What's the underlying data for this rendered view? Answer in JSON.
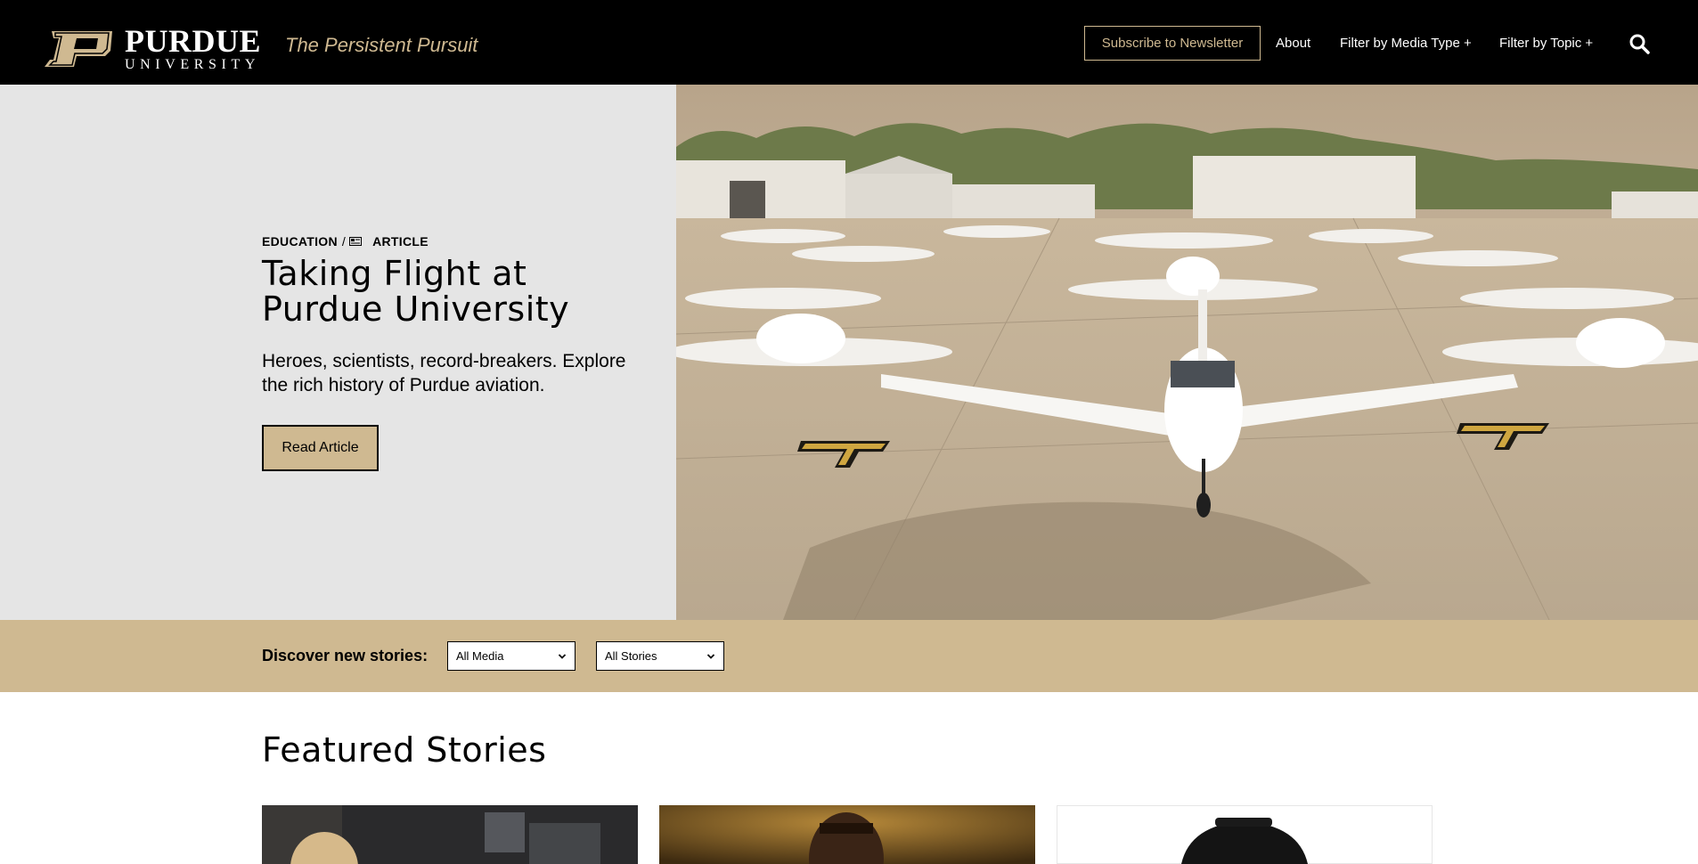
{
  "header": {
    "logo_word": "PURDUE",
    "logo_sub": "UNIVERSITY",
    "tagline": "The Persistent Pursuit",
    "subscribe_label": "Subscribe to Newsletter",
    "nav": {
      "about": "About",
      "media_type": "Filter by Media Type +",
      "topic": "Filter by Topic +"
    },
    "icons": {
      "search": "search-icon",
      "logo": "purdue-p-logo"
    }
  },
  "hero": {
    "category": "EDUCATION",
    "separator": "/",
    "media_type": "ARTICLE",
    "media_icon": "article-card-icon",
    "title": "Taking Flight at Purdue University",
    "description": "Heroes, scientists, record-breakers. Explore the rich history of Purdue aviation.",
    "button_label": "Read Article",
    "image_subject": "Purdue training airplanes parked on an airport apron in front of hangars"
  },
  "discover": {
    "label": "Discover new stories:",
    "media_select": "All Media",
    "stories_select": "All Stories"
  },
  "featured": {
    "title": "Featured Stories"
  },
  "colors": {
    "gold": "#cfb991",
    "black": "#000000",
    "hero_left_bg": "#e5e5e5"
  }
}
